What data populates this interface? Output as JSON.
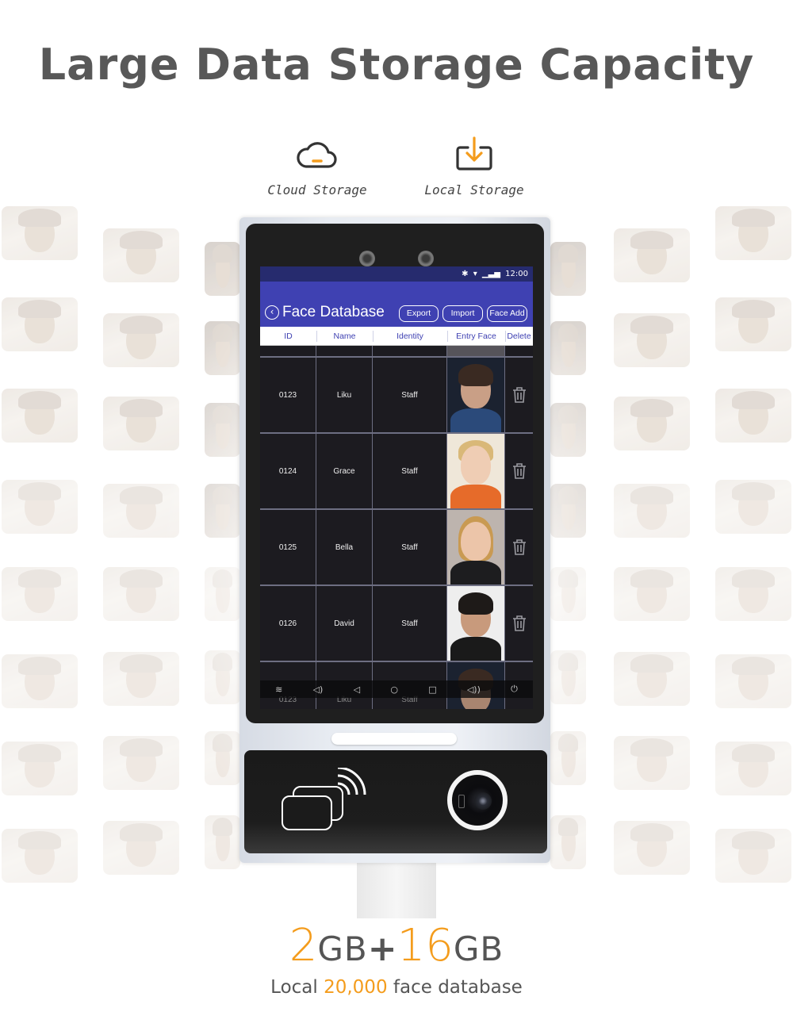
{
  "header": {
    "title": "Large Data Storage Capacity"
  },
  "storage_options": [
    {
      "icon": "cloud-icon",
      "label": "Cloud Storage"
    },
    {
      "icon": "download-tray-icon",
      "label": "Local Storage"
    }
  ],
  "colors": {
    "accent": "#f49c1c",
    "title_gray": "#585858",
    "app_bar": "#3f41b2",
    "status_bar": "#262b6e"
  },
  "device": {
    "status_bar": {
      "icons": [
        "bluetooth-icon",
        "wifi-icon",
        "signal-icon"
      ],
      "time": "12:00"
    },
    "app": {
      "title": "Face Database",
      "buttons": {
        "export": "Export",
        "import": "Import",
        "face_add": "Face Add"
      },
      "columns": [
        "ID",
        "Name",
        "Identity",
        "Entry Face",
        "Delete"
      ],
      "rows": [
        {
          "id": "0123",
          "name": "Liku",
          "identity": "Staff"
        },
        {
          "id": "0124",
          "name": "Grace",
          "identity": "Staff"
        },
        {
          "id": "0125",
          "name": "Bella",
          "identity": "Staff"
        },
        {
          "id": "0126",
          "name": "David",
          "identity": "Staff"
        }
      ],
      "overlay_row": {
        "id": "0123",
        "name": "Liku",
        "identity": "Staff"
      }
    },
    "nav_bar": [
      "collapse-icon",
      "volume-down-icon",
      "back-icon",
      "home-icon",
      "recents-icon",
      "volume-up-icon",
      "power-icon"
    ]
  },
  "capacity": {
    "ram_value": "2",
    "ram_unit": "GB",
    "plus": "+",
    "storage_value": "16",
    "storage_unit": "GB",
    "line_prefix": "Local ",
    "face_count": "20,000",
    "line_suffix": " face database"
  }
}
